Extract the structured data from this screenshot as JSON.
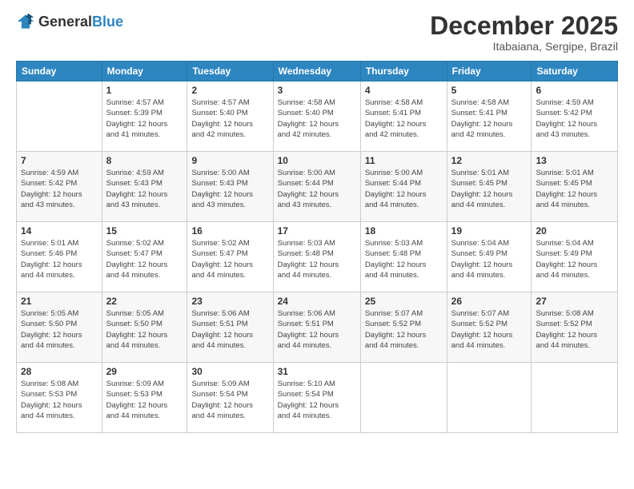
{
  "header": {
    "logo_general": "General",
    "logo_blue": "Blue",
    "month_title": "December 2025",
    "subtitle": "Itabaiana, Sergipe, Brazil"
  },
  "days_of_week": [
    "Sunday",
    "Monday",
    "Tuesday",
    "Wednesday",
    "Thursday",
    "Friday",
    "Saturday"
  ],
  "weeks": [
    [
      {
        "day": "",
        "info": ""
      },
      {
        "day": "1",
        "info": "Sunrise: 4:57 AM\nSunset: 5:39 PM\nDaylight: 12 hours\nand 41 minutes."
      },
      {
        "day": "2",
        "info": "Sunrise: 4:57 AM\nSunset: 5:40 PM\nDaylight: 12 hours\nand 42 minutes."
      },
      {
        "day": "3",
        "info": "Sunrise: 4:58 AM\nSunset: 5:40 PM\nDaylight: 12 hours\nand 42 minutes."
      },
      {
        "day": "4",
        "info": "Sunrise: 4:58 AM\nSunset: 5:41 PM\nDaylight: 12 hours\nand 42 minutes."
      },
      {
        "day": "5",
        "info": "Sunrise: 4:58 AM\nSunset: 5:41 PM\nDaylight: 12 hours\nand 42 minutes."
      },
      {
        "day": "6",
        "info": "Sunrise: 4:59 AM\nSunset: 5:42 PM\nDaylight: 12 hours\nand 43 minutes."
      }
    ],
    [
      {
        "day": "7",
        "info": "Sunrise: 4:59 AM\nSunset: 5:42 PM\nDaylight: 12 hours\nand 43 minutes."
      },
      {
        "day": "8",
        "info": "Sunrise: 4:59 AM\nSunset: 5:43 PM\nDaylight: 12 hours\nand 43 minutes."
      },
      {
        "day": "9",
        "info": "Sunrise: 5:00 AM\nSunset: 5:43 PM\nDaylight: 12 hours\nand 43 minutes."
      },
      {
        "day": "10",
        "info": "Sunrise: 5:00 AM\nSunset: 5:44 PM\nDaylight: 12 hours\nand 43 minutes."
      },
      {
        "day": "11",
        "info": "Sunrise: 5:00 AM\nSunset: 5:44 PM\nDaylight: 12 hours\nand 44 minutes."
      },
      {
        "day": "12",
        "info": "Sunrise: 5:01 AM\nSunset: 5:45 PM\nDaylight: 12 hours\nand 44 minutes."
      },
      {
        "day": "13",
        "info": "Sunrise: 5:01 AM\nSunset: 5:45 PM\nDaylight: 12 hours\nand 44 minutes."
      }
    ],
    [
      {
        "day": "14",
        "info": "Sunrise: 5:01 AM\nSunset: 5:46 PM\nDaylight: 12 hours\nand 44 minutes."
      },
      {
        "day": "15",
        "info": "Sunrise: 5:02 AM\nSunset: 5:47 PM\nDaylight: 12 hours\nand 44 minutes."
      },
      {
        "day": "16",
        "info": "Sunrise: 5:02 AM\nSunset: 5:47 PM\nDaylight: 12 hours\nand 44 minutes."
      },
      {
        "day": "17",
        "info": "Sunrise: 5:03 AM\nSunset: 5:48 PM\nDaylight: 12 hours\nand 44 minutes."
      },
      {
        "day": "18",
        "info": "Sunrise: 5:03 AM\nSunset: 5:48 PM\nDaylight: 12 hours\nand 44 minutes."
      },
      {
        "day": "19",
        "info": "Sunrise: 5:04 AM\nSunset: 5:49 PM\nDaylight: 12 hours\nand 44 minutes."
      },
      {
        "day": "20",
        "info": "Sunrise: 5:04 AM\nSunset: 5:49 PM\nDaylight: 12 hours\nand 44 minutes."
      }
    ],
    [
      {
        "day": "21",
        "info": "Sunrise: 5:05 AM\nSunset: 5:50 PM\nDaylight: 12 hours\nand 44 minutes."
      },
      {
        "day": "22",
        "info": "Sunrise: 5:05 AM\nSunset: 5:50 PM\nDaylight: 12 hours\nand 44 minutes."
      },
      {
        "day": "23",
        "info": "Sunrise: 5:06 AM\nSunset: 5:51 PM\nDaylight: 12 hours\nand 44 minutes."
      },
      {
        "day": "24",
        "info": "Sunrise: 5:06 AM\nSunset: 5:51 PM\nDaylight: 12 hours\nand 44 minutes."
      },
      {
        "day": "25",
        "info": "Sunrise: 5:07 AM\nSunset: 5:52 PM\nDaylight: 12 hours\nand 44 minutes."
      },
      {
        "day": "26",
        "info": "Sunrise: 5:07 AM\nSunset: 5:52 PM\nDaylight: 12 hours\nand 44 minutes."
      },
      {
        "day": "27",
        "info": "Sunrise: 5:08 AM\nSunset: 5:52 PM\nDaylight: 12 hours\nand 44 minutes."
      }
    ],
    [
      {
        "day": "28",
        "info": "Sunrise: 5:08 AM\nSunset: 5:53 PM\nDaylight: 12 hours\nand 44 minutes."
      },
      {
        "day": "29",
        "info": "Sunrise: 5:09 AM\nSunset: 5:53 PM\nDaylight: 12 hours\nand 44 minutes."
      },
      {
        "day": "30",
        "info": "Sunrise: 5:09 AM\nSunset: 5:54 PM\nDaylight: 12 hours\nand 44 minutes."
      },
      {
        "day": "31",
        "info": "Sunrise: 5:10 AM\nSunset: 5:54 PM\nDaylight: 12 hours\nand 44 minutes."
      },
      {
        "day": "",
        "info": ""
      },
      {
        "day": "",
        "info": ""
      },
      {
        "day": "",
        "info": ""
      }
    ]
  ]
}
